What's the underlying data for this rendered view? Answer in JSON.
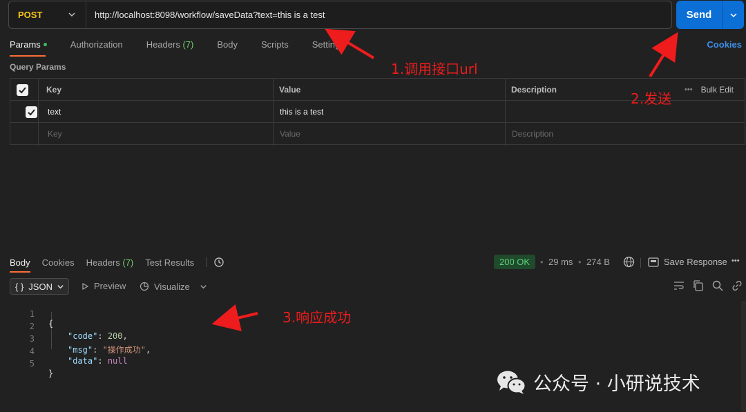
{
  "request": {
    "method": "POST",
    "url": "http://localhost:8098/workflow/saveData?text=this is a test",
    "send_label": "Send"
  },
  "request_tabs": {
    "params": "Params",
    "authorization": "Authorization",
    "headers": "Headers",
    "headers_count": "(7)",
    "body": "Body",
    "scripts": "Scripts",
    "settings": "Settings",
    "cookies": "Cookies"
  },
  "query_params": {
    "title": "Query Params",
    "bulk_edit": "Bulk Edit",
    "headers": {
      "key": "Key",
      "value": "Value",
      "description": "Description"
    },
    "rows": [
      {
        "checked": true,
        "key": "text",
        "value": "this is a test",
        "description": ""
      }
    ],
    "placeholders": {
      "key": "Key",
      "value": "Value",
      "description": "Description"
    }
  },
  "response_tabs": {
    "body": "Body",
    "cookies": "Cookies",
    "headers": "Headers",
    "headers_count": "(7)",
    "test_results": "Test Results"
  },
  "response_meta": {
    "status": "200 OK",
    "time": "29 ms",
    "size": "274 B",
    "save_response": "Save Response"
  },
  "response_view": {
    "format": "JSON",
    "preview": "Preview",
    "visualize": "Visualize"
  },
  "code_lines": [
    {
      "num": "1",
      "text": "{"
    },
    {
      "num": "2",
      "key": "\"code\"",
      "value": "200",
      "value_type": "number",
      "trail": ","
    },
    {
      "num": "3",
      "key": "\"msg\"",
      "value": "\"操作成功\"",
      "value_type": "string",
      "trail": ","
    },
    {
      "num": "4",
      "key": "\"data\"",
      "value": "null",
      "value_type": "null",
      "trail": ""
    },
    {
      "num": "5",
      "text": "}"
    }
  ],
  "annotations": {
    "step1": "1.调用接口url",
    "step2": "2.发送",
    "step3": "3.响应成功"
  },
  "watermark": "公众号 · 小研说技术",
  "colors": {
    "accent": "#ff6c37",
    "send_blue": "#0b6fd6",
    "method_yellow": "#f5c518",
    "status_green": "#5dd07a",
    "annotation_red": "#ee1c1c"
  }
}
